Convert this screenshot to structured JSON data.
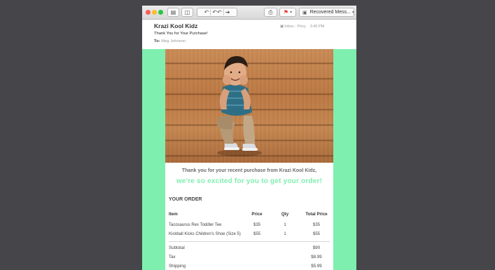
{
  "toolbar": {
    "mailbox": "Recovered Mess...",
    "icons": [
      "close-light",
      "minimize-light",
      "zoom-light",
      "delete-icon",
      "junk-icon",
      "reply-icon",
      "reply-all-icon",
      "forward-icon",
      "print-icon",
      "flag-icon",
      "mailbox-icon"
    ]
  },
  "header": {
    "sender": "Krazi Kool Kidz",
    "folder": "Inbox - Privy",
    "time": "3:40 PM",
    "subject": "Thank You for Your Purchase!",
    "to_label": "To:",
    "to_name": "Meg Johnson"
  },
  "email": {
    "thanks": "Thank you for your recent purchase from Krazi Kool Kidz,",
    "excited": "we're so excited for you to get your order!",
    "order_title": "YOUR ORDER",
    "columns": [
      "Item",
      "Price",
      "Qty",
      "Total Price"
    ],
    "items": [
      {
        "item": "Tacosaurus Rex Toddler Tee",
        "price": "$35",
        "qty": "1",
        "total": "$35"
      },
      {
        "item": "Kickball Kicks Children's Shoe (Size 5)",
        "price": "$55",
        "qty": "1",
        "total": "$55"
      }
    ],
    "totals": [
      {
        "label": "Subtotal",
        "value": "$90"
      },
      {
        "label": "Tax",
        "value": "$8.99"
      },
      {
        "label": "Shipping",
        "value": "$5.99"
      }
    ]
  },
  "colors": {
    "accent": "#7fefaf",
    "desktop": "#464549"
  }
}
